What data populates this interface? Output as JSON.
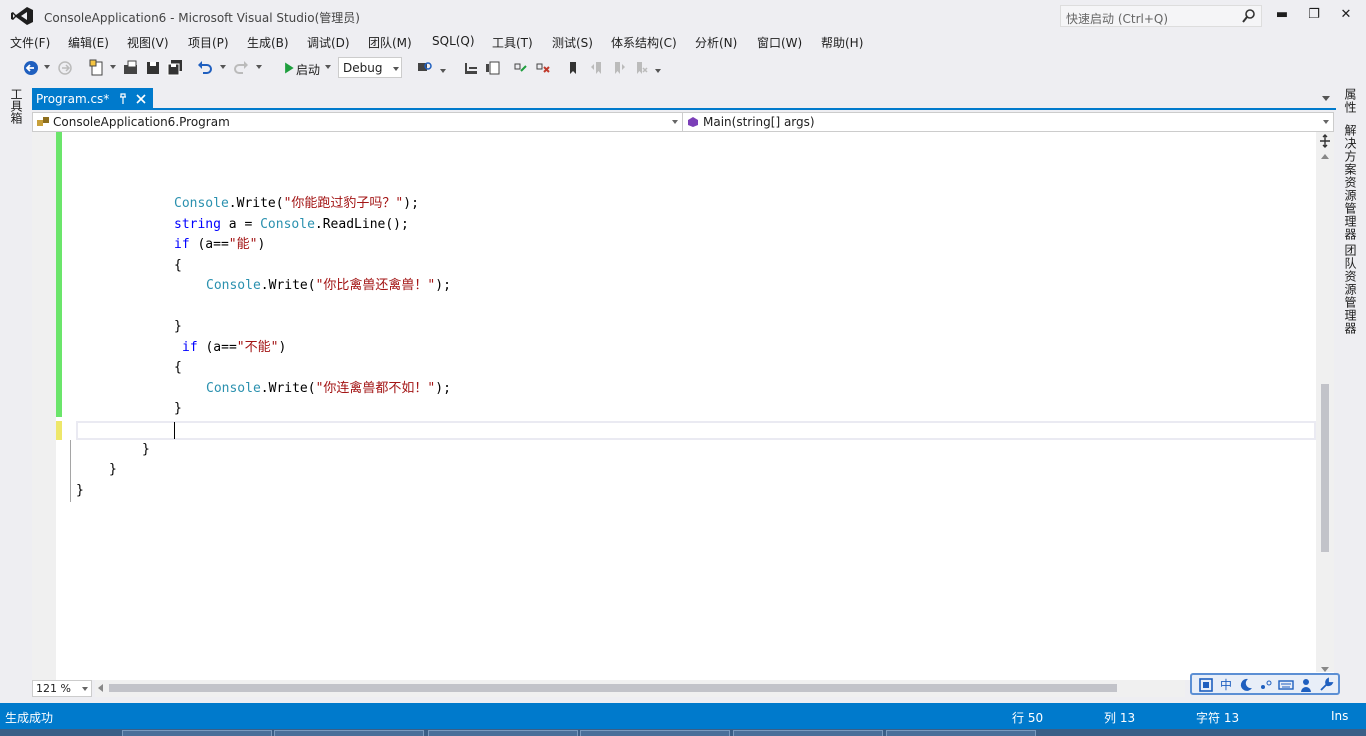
{
  "window": {
    "title": "ConsoleApplication6 - Microsoft Visual Studio(管理员)",
    "quick_launch_placeholder": "快速启动 (Ctrl+Q)",
    "minimize": "▬",
    "maximize": "❐",
    "close": "✕"
  },
  "menu": {
    "items": [
      "文件(F)",
      "编辑(E)",
      "视图(V)",
      "项目(P)",
      "生成(B)",
      "调试(D)",
      "团队(M)",
      "SQL(Q)",
      "工具(T)",
      "测试(S)",
      "体系结构(C)",
      "分析(N)",
      "窗口(W)",
      "帮助(H)"
    ]
  },
  "toolbar": {
    "start_label": "启动",
    "configuration": "Debug"
  },
  "side_tabs": {
    "left": "工具箱",
    "right": [
      "属性",
      "解决方案资源管理器",
      "团队资源管理器"
    ]
  },
  "document": {
    "tab_label": "Program.cs*"
  },
  "navigation": {
    "class_scope": "ConsoleApplication6.Program",
    "member_scope": "Main(string[] args)"
  },
  "code": {
    "line1": {
      "p1": "Console",
      "p2": ".Write(",
      "p3": "\"你能跑过豹子吗？\"",
      "p4": ");"
    },
    "line2": {
      "p1": "string",
      "p2": " a = ",
      "p3": "Console",
      "p4": ".ReadLine();"
    },
    "line3": {
      "p1": "if",
      "p2": " (a==",
      "p3": "\"能\"",
      "p4": ")"
    },
    "line4": "{",
    "line5": {
      "p1": "Console",
      "p2": ".Write(",
      "p3": "\"你比禽兽还禽兽！\"",
      "p4": ");"
    },
    "line6": "}",
    "line7": {
      "p1": "if",
      "p2": " (a==",
      "p3": "\"不能\"",
      "p4": ")"
    },
    "line8": "{",
    "line9": {
      "p1": "Console",
      "p2": ".Write(",
      "p3": "\"你连禽兽都不如！\"",
      "p4": ");"
    },
    "line10": "}",
    "line11": "}",
    "line12": "}",
    "line13": "}"
  },
  "editor": {
    "zoom": "121 %"
  },
  "ime": {
    "mode": "中"
  },
  "status": {
    "message": "生成成功",
    "line": "行 50",
    "column": "列 13",
    "char": "字符 13",
    "insert_mode": "Ins"
  },
  "colors": {
    "accent": "#007acc",
    "keyword": "#0000ff",
    "type": "#2b91af",
    "string": "#a31515",
    "changed_saved": "#6be56b",
    "changed_unsaved": "#eee76a"
  }
}
